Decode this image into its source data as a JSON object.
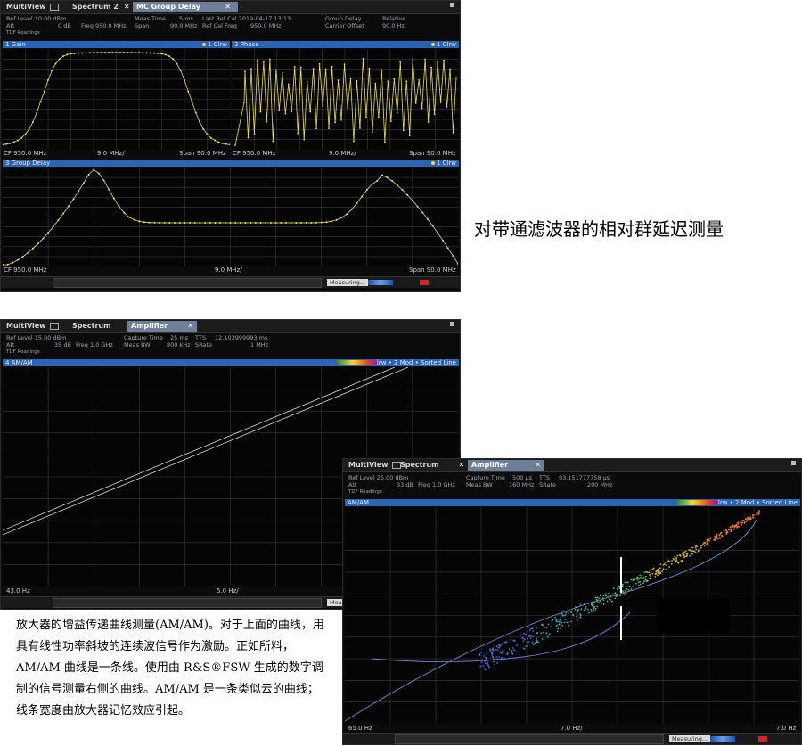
{
  "win1": {
    "tabs": [
      {
        "label": "MultiView"
      },
      {
        "label": "Spectrum 2"
      },
      {
        "label": "MC Group Delay"
      }
    ],
    "info": {
      "ref_level": "Ref Level  10.00 dBm",
      "att": "Att",
      "att_val": "0 dB",
      "freq": "Freq  950.0 MHz",
      "tdf": "TDF Readings",
      "meas_time": "Meas Time",
      "meas_time_val": "5 ms",
      "span": "Span",
      "span_val": "90.0 MHz",
      "last_ref_cal": "Last Ref Cal 2019-04-17 13:13",
      "ref_cal_freq": "Ref Cal Freq",
      "ref_cal_freq_val": "950.0 MHz",
      "group_delay": "Group Delay",
      "group_delay_val": "Relative",
      "carrier_offset": "Carrier Offset",
      "carrier_offset_val": "90.0 Hz"
    },
    "panels": {
      "gain": {
        "title": "1 Gain",
        "trace": "1 Clrw"
      },
      "phase": {
        "title": "2 Phase",
        "trace": "1 Clrw"
      },
      "delay": {
        "title": "3 Group Delay",
        "trace": "1 Clrw"
      }
    },
    "footers": {
      "gain_left": "CF 950.0 MHz",
      "gain_mid": "9.0 MHz/",
      "gain_right": "Span 90.0 MHz",
      "phase_left": "CF 950.0 MHz",
      "phase_mid": "9.0 MHz/",
      "phase_right": "Span 90.0 MHz",
      "delay_left": "CF 950.0 MHz",
      "delay_mid": "9.0 MHz/",
      "delay_right": "Span 90.0 MHz"
    },
    "status": "Measuring..."
  },
  "caption1": "对带通滤波器的相对群延迟测量",
  "win2": {
    "tabs": [
      {
        "label": "MultiView"
      },
      {
        "label": "Spectrum"
      },
      {
        "label": "Amplifier"
      }
    ],
    "info": {
      "ref_level": "Ref Level  15.00 dBm",
      "att": "Att",
      "att_val": "35 dB",
      "freq": "Freq  1.0 GHz",
      "tdf": "TDF Readings",
      "capture_time": "Capture Time",
      "capture_time_val": "25 ms",
      "meas_bw": "Meas BW",
      "meas_bw_val": "800 kHz",
      "tts": "TTS",
      "tts_val": "12.103999993 ms",
      "srate": "SRate",
      "srate_val": "1 MHz"
    },
    "panel": {
      "title": "4 AM/AM",
      "trace": "1 Clrw • 2 Mod • Sorted Line"
    },
    "footers": {
      "left": "43.0 Hz",
      "mid": "5.0 Hz/"
    },
    "status": "Meas"
  },
  "win3": {
    "tabs": [
      {
        "label": "MultiView"
      },
      {
        "label": "Spectrum"
      },
      {
        "label": "Amplifier"
      }
    ],
    "info": {
      "ref_level": "Ref Level  25.00 dBm",
      "att": "Att",
      "att_val": "33 dB",
      "freq": "Freq  1.0 GHz",
      "tdf": "TDF Readings",
      "capture_time": "Capture Time",
      "capture_time_val": "500 µs",
      "meas_bw": "Meas BW",
      "meas_bw_val": "160 MHz",
      "tts": "TTS",
      "tts_val": "93.151777758 µs",
      "srate": "SRate",
      "srate_val": "200 MHz"
    },
    "panel": {
      "title": "AM/AM",
      "trace": "1 Clrw • 2 Mod • Sorted Line"
    },
    "footers": {
      "left": "65.0 Hz",
      "mid": "7.0 Hz/",
      "right": "7.0 Hz"
    },
    "status": "Measuring..."
  },
  "caption2": "放大器的增益传递曲线测量(AM/AM)。对于上面的曲线，用具有线性功率斜坡的连续波信号作为激励。正如所料，AM/AM 曲线是一条线。使用由 R&S®FSW 生成的数字调制的信号测量右侧的曲线。AM/AM 是一条类似云的曲线；线条宽度由放大器记忆效应引起。",
  "colors": {
    "trace": "#e8dc6a",
    "title_bar": "#2b63b5",
    "grid": "#3a3a3a"
  }
}
